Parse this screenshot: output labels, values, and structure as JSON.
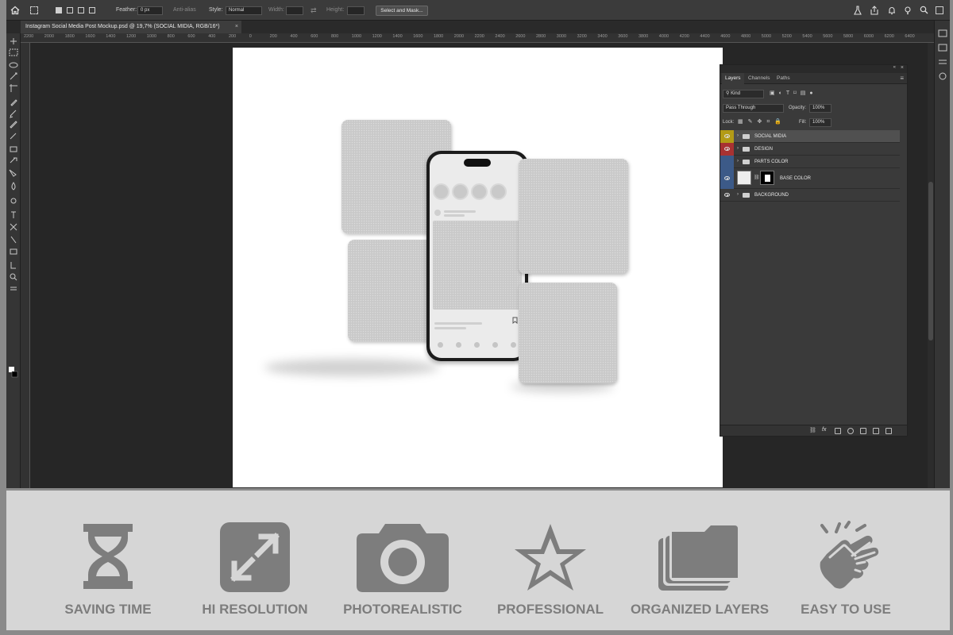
{
  "options_bar": {
    "feather_label": "Feather:",
    "feather_value": "0 px",
    "antialias_label": "Anti-alias",
    "style_label": "Style:",
    "style_value": "Normal",
    "width_label": "Width:",
    "height_label": "Height:",
    "select_mask_label": "Select and Mask..."
  },
  "document": {
    "tab_title": "Instagram Social Media Post Mockup.psd @ 19,7% (SOCIAL MIDIA, RGB/16*)",
    "close_glyph": "×"
  },
  "ruler_ticks": [
    "2200",
    "2000",
    "1800",
    "1600",
    "1400",
    "1200",
    "1000",
    "800",
    "600",
    "400",
    "200",
    "0",
    "200",
    "400",
    "600",
    "800",
    "1000",
    "1200",
    "1400",
    "1600",
    "1800",
    "2000",
    "2200",
    "2400",
    "2600",
    "2800",
    "3000",
    "3200",
    "3400",
    "3600",
    "3800",
    "4000",
    "4200",
    "4400",
    "4600",
    "4800",
    "5000",
    "5200",
    "5400",
    "5600",
    "5800",
    "6000",
    "6200",
    "6400"
  ],
  "layers_panel": {
    "tabs": [
      "Layers",
      "Channels",
      "Paths"
    ],
    "active_tab": "Layers",
    "filter_kind": "Kind",
    "blend_mode": "Pass Through",
    "opacity_label": "Opacity:",
    "opacity_value": "100%",
    "lock_label": "Lock:",
    "fill_label": "Fill:",
    "fill_value": "100%",
    "layers": [
      {
        "name": "SOCIAL MIDIA",
        "eye_color": "#b39b16",
        "type": "group",
        "visible": true,
        "selected": true
      },
      {
        "name": "DESIGN",
        "eye_color": "#a83232",
        "type": "group",
        "visible": true,
        "selected": false
      },
      {
        "name": "PARTS COLOR",
        "eye_color": "#3c5a88",
        "type": "group",
        "visible": false,
        "selected": false
      },
      {
        "name": "BASE COLOR",
        "eye_color": "#3c5a88",
        "type": "layer",
        "visible": true,
        "selected": false
      },
      {
        "name": "BACKGROUND",
        "eye_color": "#3a3a3a",
        "type": "group",
        "visible": true,
        "selected": false
      }
    ]
  },
  "features": [
    {
      "label": "SAVING TIME",
      "icon": "hourglass-icon"
    },
    {
      "label": "HI RESOLUTION",
      "icon": "expand-arrows-icon"
    },
    {
      "label": "PHOTOREALISTIC",
      "icon": "camera-icon"
    },
    {
      "label": "PROFESSIONAL",
      "icon": "star-icon"
    },
    {
      "label": "ORGANIZED LAYERS",
      "icon": "stacked-folders-icon"
    },
    {
      "label": "EASY TO USE",
      "icon": "pointing-hand-icon"
    }
  ],
  "colors": {
    "feature_gray": "#7d7d7d",
    "panel_bg": "#3a3a3a",
    "workspace_bg": "#262626"
  }
}
